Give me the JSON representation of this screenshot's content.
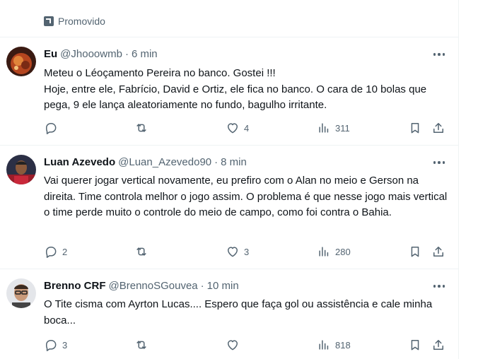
{
  "promoted": {
    "label": "Promovido",
    "icon": "promoted-arrow-icon"
  },
  "tweets": [
    {
      "name": "Eu",
      "handle": "@Jhooowmb",
      "separator": "·",
      "time": "6 min",
      "text": "Meteu o Léoçamento Pereira no banco. Gostei !!!\nHoje, entre ele, Fabrício, David e Ortiz, ele fica no banco. O cara de 10 bolas que pega, 9 ele lança aleatoriamente no fundo, bagulho irritante.",
      "replies": "",
      "retweets": "",
      "likes": "4",
      "views": "311"
    },
    {
      "name": "Luan Azevedo",
      "handle": "@Luan_Azevedo90",
      "separator": "·",
      "time": "8 min",
      "text": "Vai querer jogar vertical novamente, eu prefiro com o Alan no meio e Gerson na direita. Time controla melhor o jogo assim. O problema é que nesse jogo mais vertical o time perde muito o controle do meio de campo, como foi contra o Bahia.",
      "replies": "2",
      "retweets": "",
      "likes": "3",
      "views": "280"
    },
    {
      "name": "Brenno CRF",
      "handle": "@BrennoSGouvea",
      "separator": "·",
      "time": "10 min",
      "text": "O Tite cisma com Ayrton Lucas.... Espero que faça gol ou assistência e cale minha boca...",
      "replies": "3",
      "retweets": "",
      "likes": "",
      "views": "818"
    }
  ],
  "colors": {
    "text": "#0f1419",
    "muted": "#536471",
    "divider": "#eff3f4"
  }
}
